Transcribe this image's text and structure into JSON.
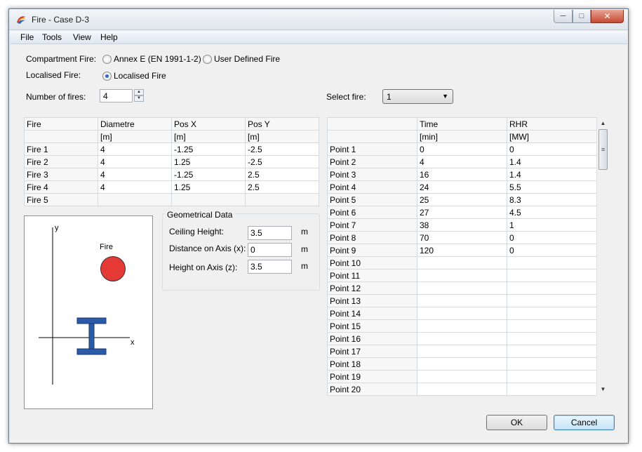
{
  "window": {
    "title": "Fire - Case D-3"
  },
  "menu": [
    "File",
    "Tools",
    "View",
    "Help"
  ],
  "fire_type": {
    "compartment_label": "Compartment Fire:",
    "annex_label": "Annex E (EN 1991-1-2)",
    "user_defined_label": "User Defined Fire",
    "localised_label": "Localised Fire:",
    "localised_option": "Localised Fire",
    "selected": "localised"
  },
  "num_fires": {
    "label": "Number of fires:",
    "value": "4"
  },
  "select_fire": {
    "label": "Select fire:",
    "value": "1"
  },
  "fires_table": {
    "headers": [
      "Fire",
      "Diametre",
      "Pos X",
      "Pos Y"
    ],
    "units": [
      "",
      "[m]",
      "[m]",
      "[m]"
    ],
    "rows": [
      [
        "Fire 1",
        "4",
        "-1.25",
        "-2.5"
      ],
      [
        "Fire 2",
        "4",
        "1.25",
        "-2.5"
      ],
      [
        "Fire 3",
        "4",
        "-1.25",
        "2.5"
      ],
      [
        "Fire 4",
        "4",
        "1.25",
        "2.5"
      ],
      [
        "Fire 5",
        "",
        "",
        ""
      ]
    ]
  },
  "points_table": {
    "headers": [
      "",
      "Time",
      "RHR"
    ],
    "units": [
      "",
      "[min]",
      "[MW]"
    ],
    "rows": [
      [
        "Point 1",
        "0",
        "0"
      ],
      [
        "Point 2",
        "4",
        "1.4"
      ],
      [
        "Point 3",
        "16",
        "1.4"
      ],
      [
        "Point 4",
        "24",
        "5.5"
      ],
      [
        "Point 5",
        "25",
        "8.3"
      ],
      [
        "Point 6",
        "27",
        "4.5"
      ],
      [
        "Point 7",
        "38",
        "1"
      ],
      [
        "Point 8",
        "70",
        "0"
      ],
      [
        "Point 9",
        "120",
        "0"
      ],
      [
        "Point 10",
        "",
        ""
      ],
      [
        "Point 11",
        "",
        ""
      ],
      [
        "Point 12",
        "",
        ""
      ],
      [
        "Point 13",
        "",
        ""
      ],
      [
        "Point 14",
        "",
        ""
      ],
      [
        "Point 15",
        "",
        ""
      ],
      [
        "Point 16",
        "",
        ""
      ],
      [
        "Point 17",
        "",
        ""
      ],
      [
        "Point 18",
        "",
        ""
      ],
      [
        "Point 19",
        "",
        ""
      ],
      [
        "Point 20",
        "",
        ""
      ]
    ]
  },
  "diagram": {
    "y_label": "y",
    "x_label": "x",
    "fire_label": "Fire",
    "fire_color": "#e53935",
    "beam_color": "#2a5aa8"
  },
  "geometry": {
    "title": "Geometrical Data",
    "ceiling_label": "Ceiling Height:",
    "ceiling_value": "3.5",
    "distance_label": "Distance on Axis (x):",
    "distance_value": "0",
    "height_label": "Height on Axis (z):",
    "height_value": "3.5",
    "unit": "m"
  },
  "buttons": {
    "ok": "OK",
    "cancel": "Cancel"
  }
}
